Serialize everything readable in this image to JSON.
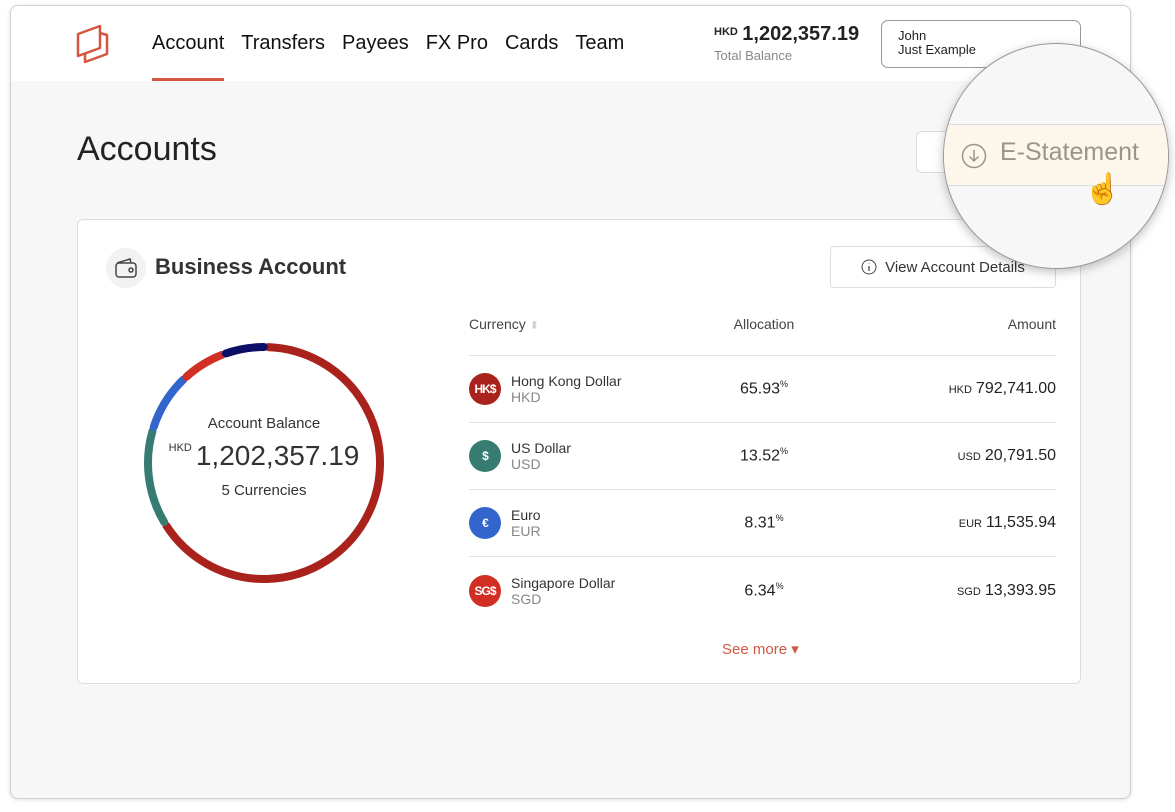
{
  "header": {
    "nav": [
      {
        "label": "Account",
        "active": true
      },
      {
        "label": "Transfers"
      },
      {
        "label": "Payees"
      },
      {
        "label": "FX Pro"
      },
      {
        "label": "Cards"
      },
      {
        "label": "Team"
      }
    ],
    "total_balance": {
      "currency": "HKD",
      "amount": "1,202,357.19",
      "label": "Total Balance"
    },
    "user": {
      "first": "John",
      "second": "Just Example"
    }
  },
  "page_title": "Accounts",
  "estatement_label": "E-Statement",
  "account": {
    "title": "Business Account",
    "view_details_label": "View Account Details",
    "balance_label": "Account Balance",
    "balance_currency": "HKD",
    "balance_amount": "1,202,357.19",
    "currency_count": "5 Currencies",
    "table": {
      "headers": {
        "currency": "Currency",
        "allocation": "Allocation",
        "amount": "Amount"
      },
      "rows": [
        {
          "symbol": "HK$",
          "name": "Hong Kong Dollar",
          "code": "HKD",
          "allocation": "65.93",
          "amount": "792,741.00",
          "color": "#a9221c"
        },
        {
          "symbol": "$",
          "name": "US Dollar",
          "code": "USD",
          "allocation": "13.52",
          "amount": "20,791.50",
          "color": "#367c72"
        },
        {
          "symbol": "€",
          "name": "Euro",
          "code": "EUR",
          "allocation": "8.31",
          "amount": "11,535.94",
          "color": "#3366cc"
        },
        {
          "symbol": "SG$",
          "name": "Singapore Dollar",
          "code": "SGD",
          "allocation": "6.34",
          "amount": "13,393.95",
          "color": "#d12e24"
        }
      ],
      "percent_sign": "%"
    },
    "see_more_label": "See more ▾",
    "donut_segments": [
      {
        "value": 65.93,
        "color": "#a9221c"
      },
      {
        "value": 13.52,
        "color": "#367c72"
      },
      {
        "value": 8.31,
        "color": "#3366cc"
      },
      {
        "value": 6.34,
        "color": "#d12e24"
      },
      {
        "value": 5.9,
        "color": "#0b0f66"
      }
    ]
  }
}
